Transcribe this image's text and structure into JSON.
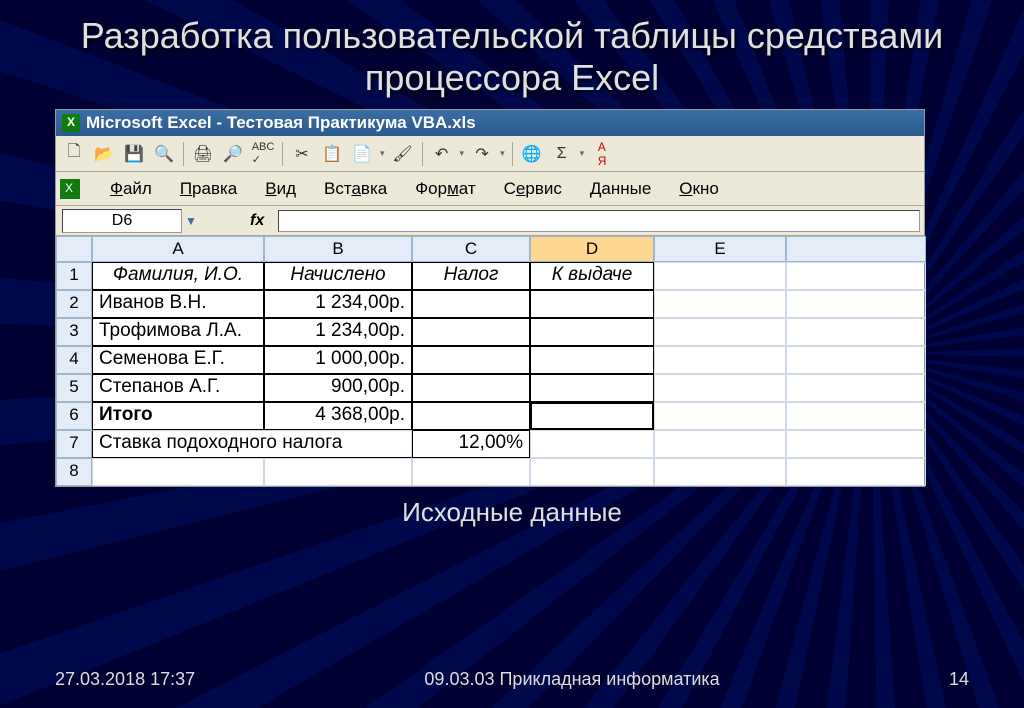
{
  "slide": {
    "title": "Разработка пользовательской таблицы средствами процессора Excel",
    "caption": "Исходные данные",
    "footer_left": "27.03.2018 17:37",
    "footer_center": "09.03.03 Прикладная информатика",
    "footer_right": "14"
  },
  "excel": {
    "window_title": "Microsoft Excel - Тестовая Практикума VBA.xls",
    "menu": {
      "file": "Файл",
      "edit": "Правка",
      "view": "Вид",
      "insert": "Вставка",
      "format": "Формат",
      "tools": "Сервис",
      "data": "Данные",
      "window": "Окно"
    },
    "namebox": "D6",
    "fx_label": "fx",
    "columns": [
      "A",
      "B",
      "C",
      "D",
      "E"
    ],
    "selected_col": "D",
    "rows": [
      "1",
      "2",
      "3",
      "4",
      "5",
      "6",
      "7",
      "8"
    ],
    "headers": {
      "a": "Фамилия, И.О.",
      "b": "Начислено",
      "c": "Налог",
      "d": "К выдаче"
    },
    "data_rows": [
      {
        "name": "Иванов В.Н.",
        "amount": "1 234,00р."
      },
      {
        "name": "Трофимова Л.А.",
        "amount": "1 234,00р."
      },
      {
        "name": "Семенова Е.Г.",
        "amount": "1 000,00р."
      },
      {
        "name": "Степанов А.Г.",
        "amount": "900,00р."
      }
    ],
    "total_label": "Итого",
    "total_amount": "4 368,00р.",
    "rate_label": "Ставка подоходного налога",
    "rate_value": "12,00%"
  },
  "chart_data": {
    "type": "table",
    "title": "Исходные данные",
    "columns": [
      "Фамилия, И.О.",
      "Начислено",
      "Налог",
      "К выдаче"
    ],
    "rows": [
      [
        "Иванов В.Н.",
        "1 234,00р.",
        "",
        ""
      ],
      [
        "Трофимова Л.А.",
        "1 234,00р.",
        "",
        ""
      ],
      [
        "Семенова Е.Г.",
        "1 000,00р.",
        "",
        ""
      ],
      [
        "Степанов А.Г.",
        "900,00р.",
        "",
        ""
      ],
      [
        "Итого",
        "4 368,00р.",
        "",
        ""
      ],
      [
        "Ставка подоходного налога",
        "",
        "12,00%",
        ""
      ]
    ]
  }
}
